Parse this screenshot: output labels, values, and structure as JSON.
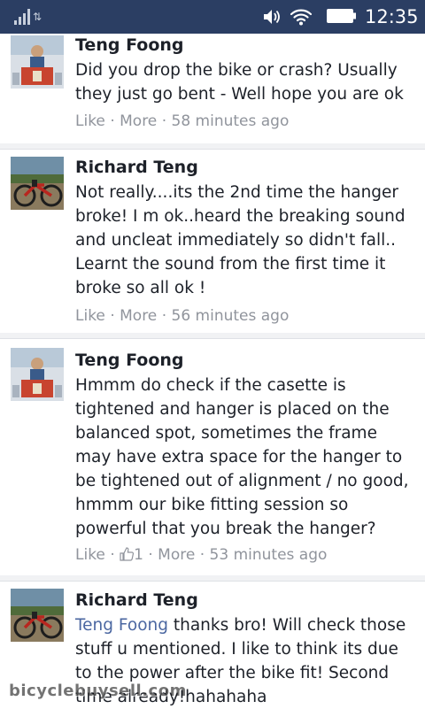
{
  "status_bar": {
    "time": "12:35",
    "signal_sub": "⇅",
    "icons": [
      "signal-icon",
      "volume-icon",
      "wifi-icon",
      "battery-icon"
    ]
  },
  "comments": [
    {
      "author": "Teng Foong",
      "avatar": "avatar-teng-foong",
      "text": "Did you drop the bike or crash? Usually\nthey just go bent - Well hope you are ok",
      "like": "Like",
      "more": "More",
      "time": "58 minutes ago"
    },
    {
      "author": "Richard Teng",
      "avatar": "avatar-richard-teng",
      "text": "Not really....its the 2nd time the hanger\nbroke! I m ok..heard the breaking sound\nand uncleat immediately so didn't fall..\nLearnt the sound from the first time it\nbroke so all ok !",
      "like": "Like",
      "more": "More",
      "time": "56 minutes ago"
    },
    {
      "author": "Teng Foong",
      "avatar": "avatar-teng-foong",
      "text": "Hmmm do check if the casette is\ntightened and hanger is placed on the\nbalanced spot, sometimes the frame\nmay have extra space for the hanger to\nbe tightened out of alignment / no good,\nhmmm our bike fitting session so\npowerful that you break the hanger?",
      "like": "Like",
      "like_count": "1",
      "more": "More",
      "time": "53 minutes ago"
    },
    {
      "author": "Richard Teng",
      "avatar": "avatar-richard-teng",
      "mention": "Teng Foong",
      "text": " thanks bro! Will check those\nstuff u mentioned. I like to think its due\nto the power after the bike fit! Second\ntime already!hahahaha"
    }
  ],
  "separator": "·",
  "watermark": "bicyclebuysell.com",
  "colors": {
    "status_bar": "#2b3e63",
    "meta_text": "#90949c",
    "mention": "#4b67a1",
    "divider": "#f1f2f4"
  }
}
